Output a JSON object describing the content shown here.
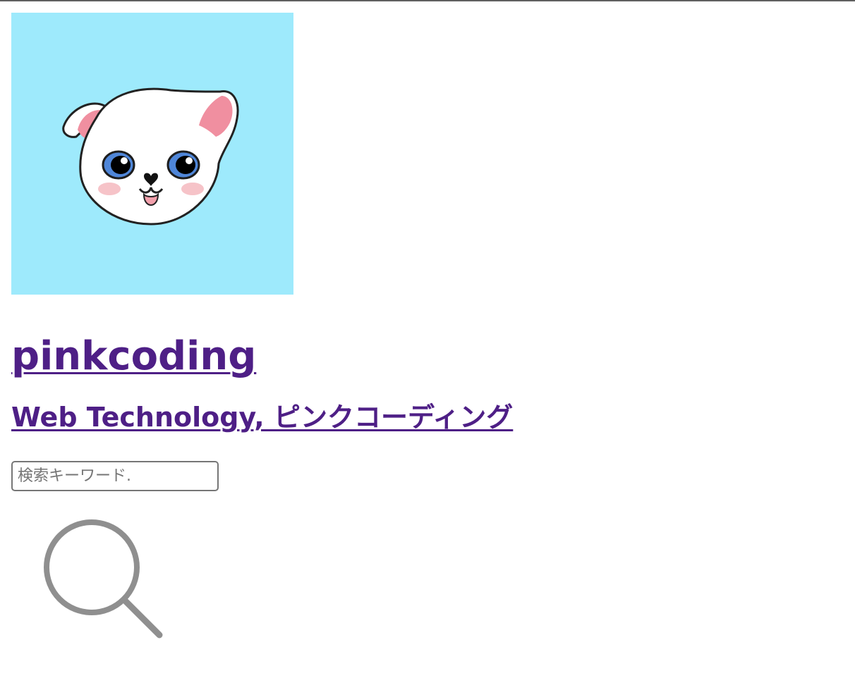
{
  "header": {
    "site_title": "pinkcoding",
    "site_description": "Web Technology, ピンクコーディング"
  },
  "avatar": {
    "icon": "cat-face-icon",
    "background_color": "#9eeafc"
  },
  "search": {
    "placeholder": "検索キーワード.",
    "value": "",
    "button_icon": "search-icon"
  },
  "colors": {
    "link": "#4e1f86",
    "icon_gray": "#8f8f8f"
  }
}
